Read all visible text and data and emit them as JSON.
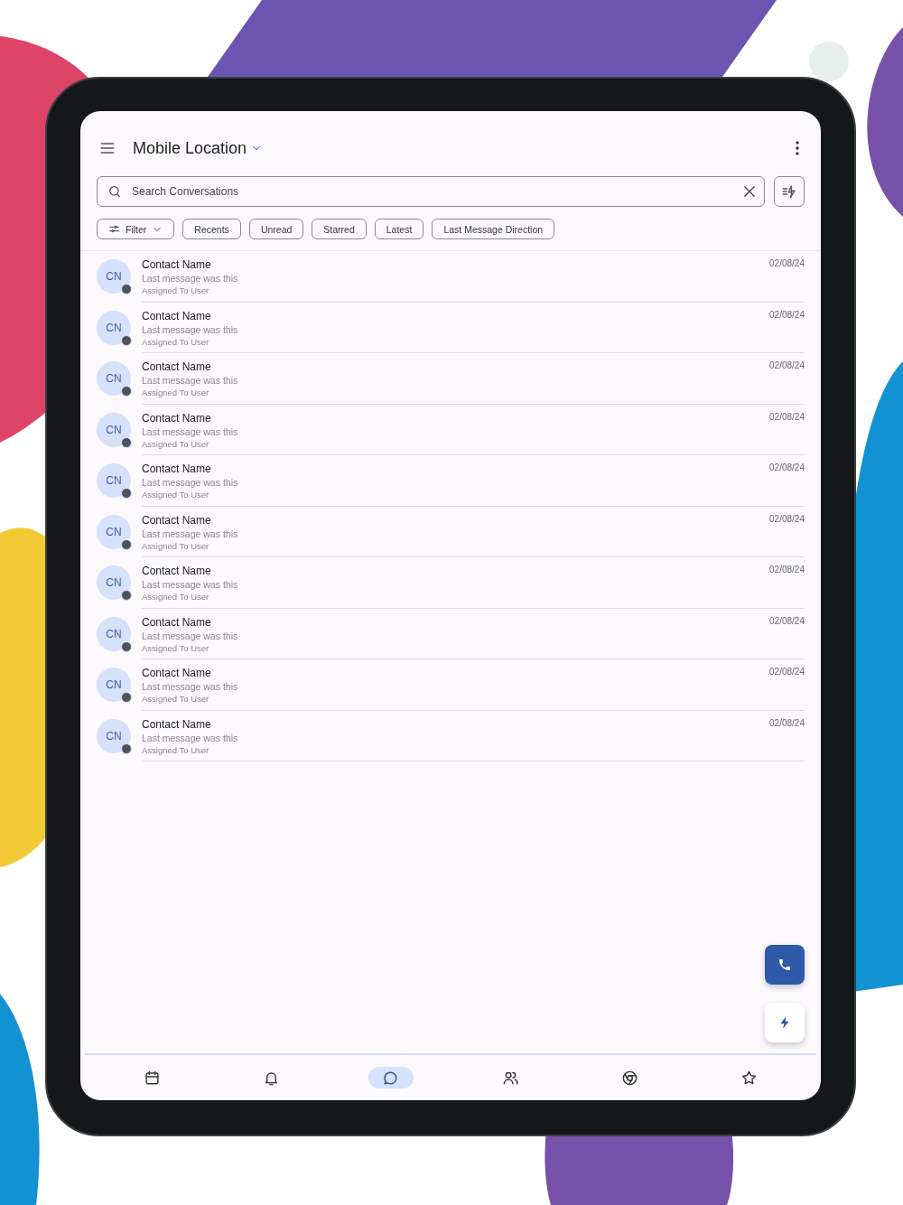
{
  "header": {
    "title": "Mobile Location"
  },
  "search": {
    "placeholder": "Search Conversations"
  },
  "chips": [
    {
      "label": "Filter",
      "kind": "filter"
    },
    {
      "label": "Recents",
      "kind": "plain"
    },
    {
      "label": "Unread",
      "kind": "plain"
    },
    {
      "label": "Starred",
      "kind": "plain"
    },
    {
      "label": "Latest",
      "kind": "plain"
    },
    {
      "label": "Last Message Direction",
      "kind": "plain"
    }
  ],
  "conversations": [
    {
      "initials": "CN",
      "name": "Contact Name",
      "message": "Last message was this",
      "assignee": "Assigned To User",
      "date": "02/08/24"
    },
    {
      "initials": "CN",
      "name": "Contact Name",
      "message": "Last message was this",
      "assignee": "Assigned To User",
      "date": "02/08/24"
    },
    {
      "initials": "CN",
      "name": "Contact Name",
      "message": "Last message was this",
      "assignee": "Assigned To User",
      "date": "02/08/24"
    },
    {
      "initials": "CN",
      "name": "Contact Name",
      "message": "Last message was this",
      "assignee": "Assigned To User",
      "date": "02/08/24"
    },
    {
      "initials": "CN",
      "name": "Contact Name",
      "message": "Last message was this",
      "assignee": "Assigned To User",
      "date": "02/08/24"
    },
    {
      "initials": "CN",
      "name": "Contact Name",
      "message": "Last message was this",
      "assignee": "Assigned To User",
      "date": "02/08/24"
    },
    {
      "initials": "CN",
      "name": "Contact Name",
      "message": "Last message was this",
      "assignee": "Assigned To User",
      "date": "02/08/24"
    },
    {
      "initials": "CN",
      "name": "Contact Name",
      "message": "Last message was this",
      "assignee": "Assigned To User",
      "date": "02/08/24"
    },
    {
      "initials": "CN",
      "name": "Contact Name",
      "message": "Last message was this",
      "assignee": "Assigned To User",
      "date": "02/08/24"
    },
    {
      "initials": "CN",
      "name": "Contact Name",
      "message": "Last message was this",
      "assignee": "Assigned To User",
      "date": "02/08/24"
    }
  ],
  "bottom_nav": [
    {
      "selected": false
    },
    {
      "selected": false
    },
    {
      "selected": true
    },
    {
      "selected": false
    },
    {
      "selected": false
    },
    {
      "selected": false
    }
  ]
}
